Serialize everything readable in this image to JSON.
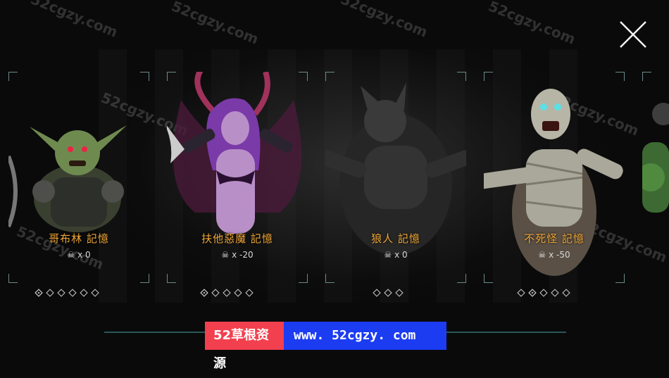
{
  "close_label": "close",
  "cards": [
    {
      "title": "哥布林 記憶",
      "kills": "x 0",
      "dots": [
        true,
        false,
        false,
        false,
        false,
        false
      ]
    },
    {
      "title": "扶他惡魔 記憶",
      "kills": "x -20",
      "dots": [
        true,
        false,
        false,
        false,
        false
      ]
    },
    {
      "title": "狼人 記憶",
      "kills": "x 0",
      "dots": [
        false,
        false,
        false
      ]
    },
    {
      "title": "不死怪 記憶",
      "kills": "x -50",
      "dots": [
        false,
        true,
        false,
        false,
        false
      ]
    }
  ],
  "watermark": {
    "left": "52草根资源",
    "right": "www. 52cgzy. com",
    "repeat": "52cgzy.com"
  },
  "colors": {
    "title": "#efa636",
    "frame": "#6b8a8a",
    "progress": "#2a5656",
    "wm_red": "#f2404f",
    "wm_blue": "#1c3cf2"
  }
}
